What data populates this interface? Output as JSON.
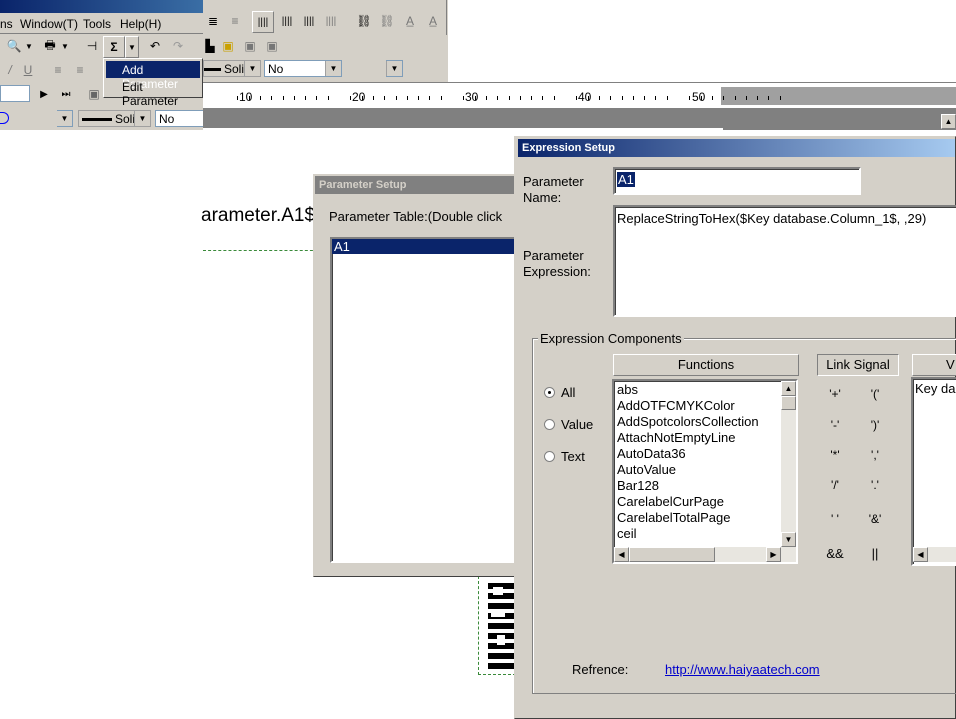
{
  "menubar": {
    "items": [
      "ns",
      "Window(T)",
      "Tools",
      "Help(H)"
    ]
  },
  "context_menu": {
    "items": [
      "Add Parameter",
      "Edit Parameter"
    ]
  },
  "toolbar": {
    "line_style_1": "Solic",
    "combo_no_1": "No",
    "line_style_2": "Solic",
    "combo_no_2": "No"
  },
  "ruler": {
    "labels": [
      "10",
      "20",
      "30",
      "40",
      "50"
    ]
  },
  "canvas": {
    "label_text": "arameter.A1$"
  },
  "parameter_setup": {
    "title": "Parameter Setup",
    "table_label": "Parameter Table:(Double click",
    "rows": [
      "A1"
    ]
  },
  "expression_setup": {
    "title": "Expression Setup",
    "name_label": "Parameter Name:",
    "name_value": "A1",
    "expr_label": "Parameter Expression:",
    "expr_value": "ReplaceStringToHex($Key database.Column_1$, ,29)",
    "components_label": "Expression Components",
    "radios": [
      "All",
      "Value",
      "Text"
    ],
    "functions_header": "Functions",
    "functions": [
      "abs",
      "AddOTFCMYKColor",
      "AddSpotcolorsCollection",
      "AttachNotEmptyLine",
      "AutoData36",
      "AutoValue",
      "Bar128",
      "CarelabelCurPage",
      "CarelabelTotalPage",
      "ceil"
    ],
    "link_signal_header": "Link Signal",
    "link_signals": [
      "'+'",
      "'('",
      "'-'",
      "')'",
      "'*'",
      "','",
      "'/'",
      "'.'",
      "' '",
      "'&'",
      "&&",
      "||"
    ],
    "values_header": "V",
    "values": [
      "Key da"
    ],
    "reference_label": "Refrence:",
    "reference_link": "http://www.haiyaatech.com"
  }
}
